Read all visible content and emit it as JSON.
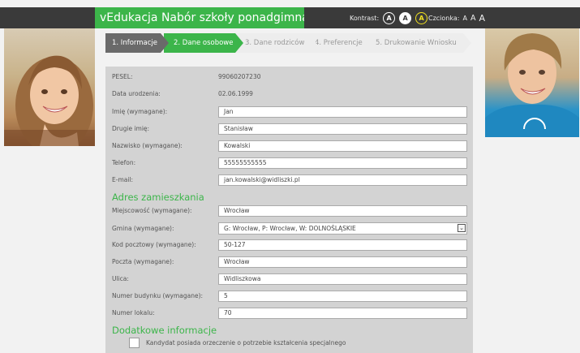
{
  "header": {
    "title": "vEdukacja Nabór szkoły ponadgimnazjalne",
    "contrast_label": "Kontrast:",
    "contrast_options": [
      "A",
      "A",
      "A"
    ],
    "font_label": "Czcionka:",
    "font_options": [
      "A",
      "A",
      "A"
    ]
  },
  "steps": [
    {
      "label": "1. Informacje",
      "state": "done"
    },
    {
      "label": "2. Dane osobowe",
      "state": "active"
    },
    {
      "label": "3. Dane rodziców",
      "state": "todo"
    },
    {
      "label": "4. Preferencje",
      "state": "todo"
    },
    {
      "label": "5. Drukowanie Wniosku",
      "state": "todo"
    }
  ],
  "personal": {
    "pesel": {
      "label": "PESEL:",
      "value": "99060207230"
    },
    "birth": {
      "label": "Data urodzenia:",
      "value": "02.06.1999"
    },
    "first_name": {
      "label": "Imię (wymagane):",
      "value": "Jan"
    },
    "second_name": {
      "label": "Drugie imię:",
      "value": "Stanisław"
    },
    "surname": {
      "label": "Nazwisko (wymagane):",
      "value": "Kowalski"
    },
    "phone": {
      "label": "Telefon:",
      "value": "55555555555"
    },
    "email": {
      "label": "E-mail:",
      "value": "jan.kowalski@widliszki.pl"
    }
  },
  "address": {
    "heading": "Adres zamieszkania",
    "city": {
      "label": "Miejscowość (wymagane):",
      "value": "Wrocław"
    },
    "gmina": {
      "label": "Gmina (wymagane):",
      "value": "G: Wrocław, P: Wrocław, W: DOLNOŚLĄSKIE"
    },
    "postcode": {
      "label": "Kod pocztowy (wymagane):",
      "value": "50-127"
    },
    "post": {
      "label": "Poczta (wymagane):",
      "value": "Wrocław"
    },
    "street": {
      "label": "Ulica:",
      "value": "Widliszkowa"
    },
    "building": {
      "label": "Numer budynku (wymagane):",
      "value": "5"
    },
    "flat": {
      "label": "Numer lokalu:",
      "value": "70"
    }
  },
  "extra": {
    "heading": "Dodatkowe informacje",
    "special_needs_label": "Kandydat posiada orzeczenie o potrzebie kształcenia specjalnego"
  }
}
